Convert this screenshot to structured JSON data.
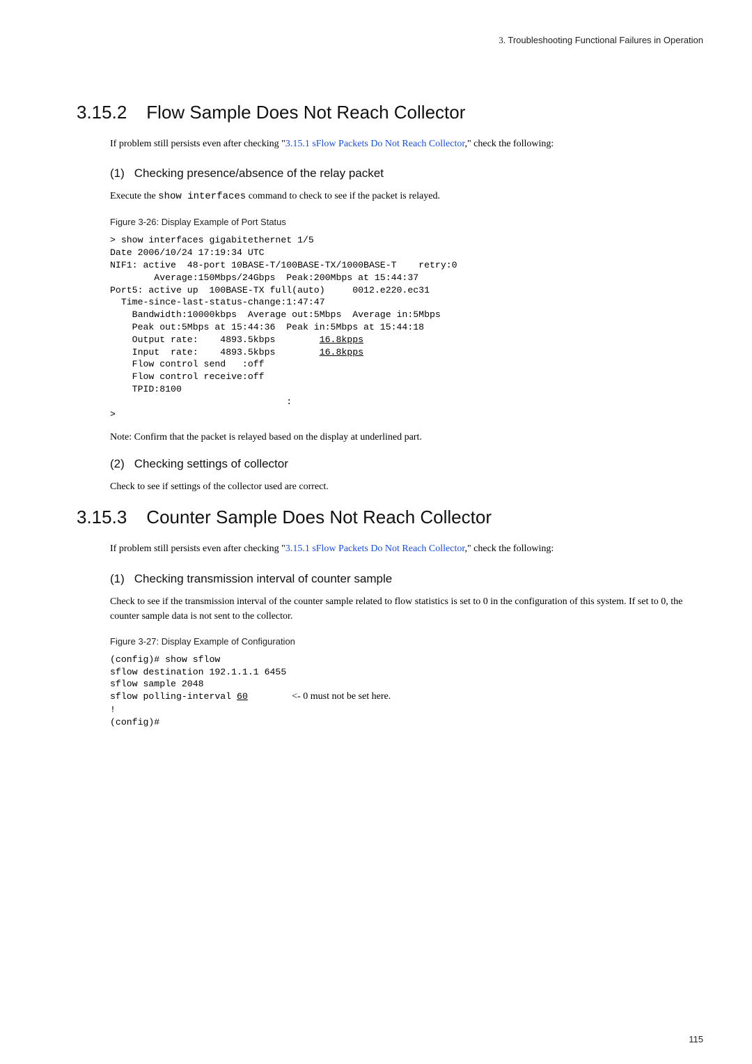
{
  "header": {
    "num": "3.",
    "text": "Troubleshooting Functional Failures in Operation"
  },
  "sec1": {
    "num": "3.15.2",
    "title": "Flow Sample Does Not Reach Collector",
    "intro_a": "If problem still persists even after checking \"",
    "intro_link": "3.15.1 sFlow Packets Do Not Reach Collector",
    "intro_b": ",\" check the following:",
    "sub1": {
      "pnum": "(1)",
      "title": "Checking presence/absence of the relay packet",
      "body_a": "Execute the ",
      "cmd": "show interfaces",
      "body_b": " command to check to see if the packet is relayed.",
      "fig_title": "Figure 3-26: Display Example of Port Status",
      "code": {
        "l01": "> show interfaces gigabitethernet 1/5",
        "l02": "Date 2006/10/24 17:19:34 UTC",
        "l03": "NIF1: active  48-port 10BASE-T/100BASE-TX/1000BASE-T    retry:0",
        "l04": "        Average:150Mbps/24Gbps  Peak:200Mbps at 15:44:37",
        "l05": "Port5: active up  100BASE-TX full(auto)     0012.e220.ec31",
        "l06": "  Time-since-last-status-change:1:47:47",
        "l07": "    Bandwidth:10000kbps  Average out:5Mbps  Average in:5Mbps",
        "l08": "    Peak out:5Mbps at 15:44:36  Peak in:5Mbps at 15:44:18",
        "l09a": "    Output rate:    4893.5kbps        ",
        "l09u": "16.8kpps",
        "l10a": "    Input  rate:    4893.5kbps        ",
        "l10u": "16.8kpps",
        "l11": "    Flow control send   :off",
        "l12": "    Flow control receive:off",
        "l13": "    TPID:8100",
        "l14": "                                :",
        "l15": ">"
      },
      "note": "Note: Confirm that the packet is relayed based on the display at underlined part."
    },
    "sub2": {
      "pnum": "(2)",
      "title": "Checking settings of collector",
      "body": "Check to see if settings of the collector used are correct."
    }
  },
  "sec2": {
    "num": "3.15.3",
    "title": "Counter Sample Does Not Reach Collector",
    "intro_a": "If problem still persists even after checking \"",
    "intro_link": "3.15.1 sFlow Packets Do Not Reach Collector",
    "intro_b": ",\" check the following:",
    "sub1": {
      "pnum": "(1)",
      "title": "Checking transmission interval of counter sample",
      "body": "Check to see if the transmission interval of the counter sample related to flow statistics is set to 0 in the configuration of this system. If set to 0, the counter sample data is not sent to the collector.",
      "fig_title": "Figure 3-27: Display Example of Configuration",
      "code": {
        "l1": "(config)# show sflow",
        "l2": "sflow destination 192.1.1.1 6455",
        "l3": "sflow sample 2048",
        "l4a": "sflow polling-interval ",
        "l4u": "60",
        "l4b": "        ",
        "l4annot": "<- 0 must not be set here.",
        "l5": "!",
        "l6": "(config)#"
      }
    }
  },
  "page_number": "115"
}
